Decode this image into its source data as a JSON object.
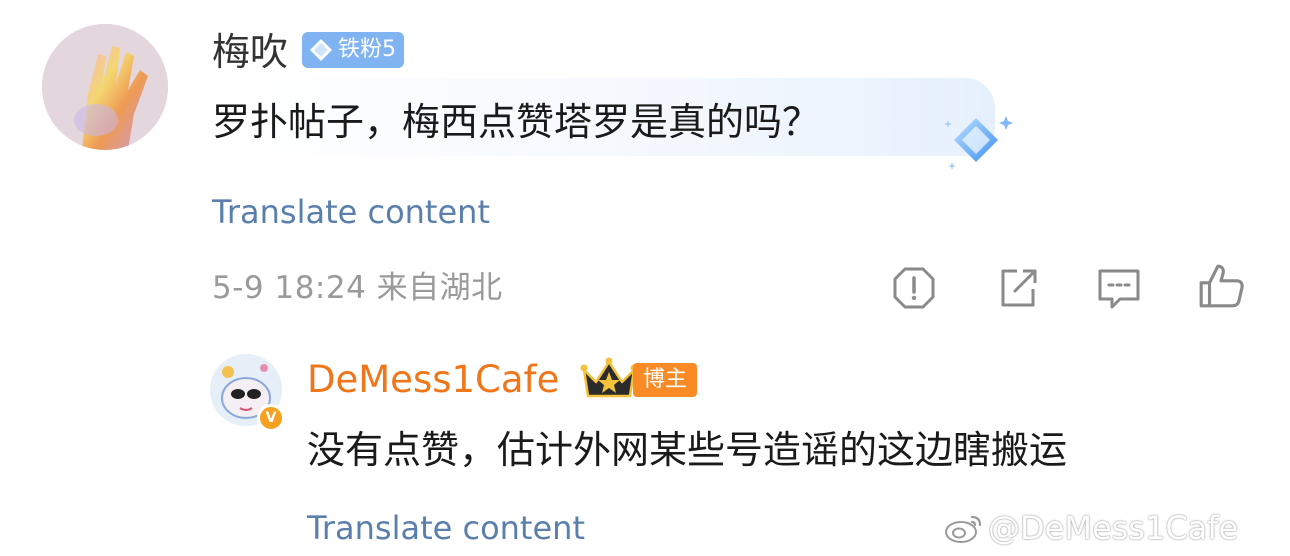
{
  "comment": {
    "username": "梅吹",
    "fan_badge": "铁粉5",
    "text": "罗扑帖子，梅西点赞塔罗是真的吗？",
    "translate_label": "Translate content",
    "meta": "5-9 18:24  来自湖北",
    "actions": {
      "report_icon": "report-icon",
      "share_icon": "share-icon",
      "reply_icon": "reply-icon",
      "like_icon": "like-icon"
    }
  },
  "reply": {
    "username": "DeMess1Cafe",
    "owner_badge": "博主",
    "verified_badge": "V",
    "text": "没有点赞，估计外网某些号造谣的这边瞎搬运",
    "translate_label": "Translate content"
  },
  "watermark": {
    "text": "@DeMess1Cafe"
  },
  "colors": {
    "link_blue": "#5a7fad",
    "reply_orange": "#f0761a",
    "fan_badge_blue": "#7fb3f2",
    "owner_badge_orange": "#f98b27",
    "meta_gray": "#9a9a9a"
  }
}
